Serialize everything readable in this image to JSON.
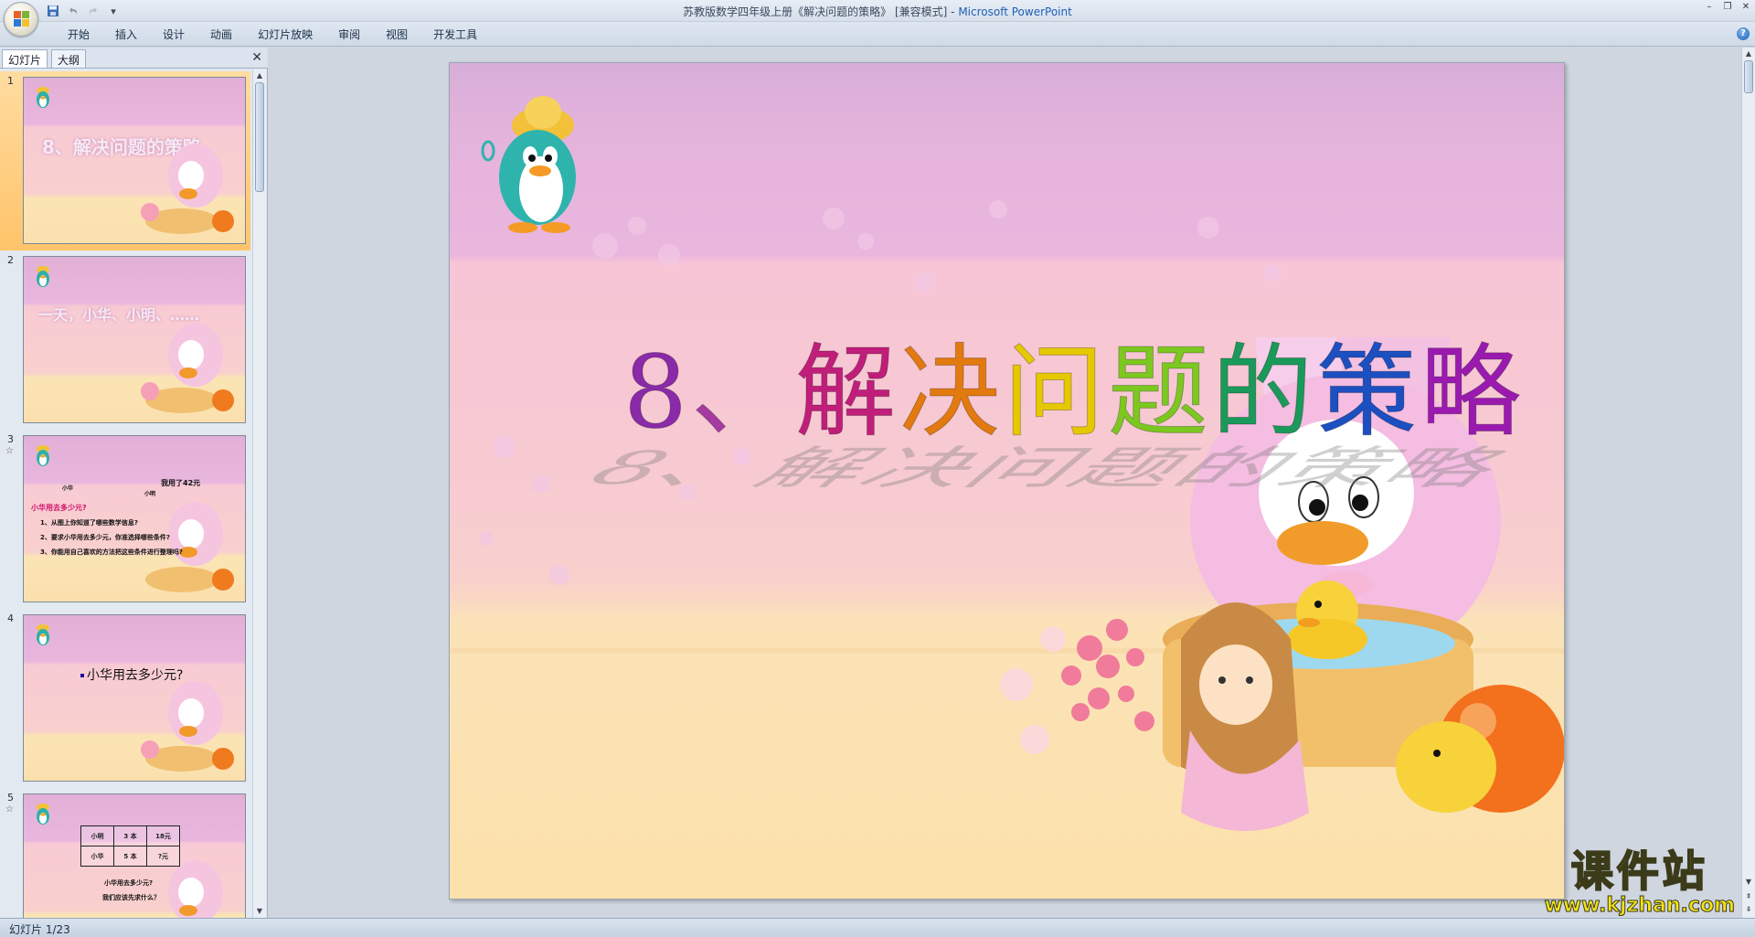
{
  "window": {
    "title": "苏教版数学四年级上册《解决问题的策略》 [兼容模式] - ",
    "app_name": "Microsoft PowerPoint",
    "controls": [
      "–",
      "❐",
      "✕"
    ]
  },
  "quick_access": {
    "save_icon": "save-icon",
    "undo_icon": "undo-icon",
    "redo_icon": "redo-icon",
    "more": "▾"
  },
  "ribbon": {
    "tabs": [
      "开始",
      "插入",
      "设计",
      "动画",
      "幻灯片放映",
      "审阅",
      "视图",
      "开发工具"
    ],
    "help": "?"
  },
  "left_pane": {
    "tabs": [
      "幻灯片",
      "大纲"
    ],
    "close": "✕",
    "slides": [
      {
        "number": "1",
        "title": "8、解决问题的策略",
        "selected": true
      },
      {
        "number": "2",
        "title": "一天，小华、小明、……"
      },
      {
        "number": "3",
        "texts": [
          "我用了42元",
          "小华",
          "小明",
          "小华用去多少元?",
          "1、从图上你知道了哪些数学信息?",
          "2、要求小华用去多少元，你准选择哪些条件?",
          "3、你能用自己喜欢的方法把这些条件进行整理吗?"
        ]
      },
      {
        "number": "4",
        "text": "小华用去多少元?"
      },
      {
        "number": "5",
        "table": [
          [
            "小明",
            "3 本",
            "18元"
          ],
          [
            "小华",
            "5 本",
            "?元"
          ]
        ],
        "texts": [
          "小华用去多少元?",
          "我们应该先求什么？"
        ]
      }
    ]
  },
  "slide": {
    "title_chars": [
      "8",
      "、",
      "解",
      "决",
      "问",
      "题",
      "的",
      "策",
      "略"
    ],
    "title_colors": [
      "#8a2aa8",
      "#a53aa0",
      "#c01e7a",
      "#e27a10",
      "#e6c800",
      "#7cc820",
      "#1a9a5a",
      "#1c4fc0",
      "#9a1ab0"
    ]
  },
  "status": {
    "text": "幻灯片 1/23"
  },
  "watermark": {
    "title": "课件站",
    "url": "www.kjzhan.com"
  }
}
